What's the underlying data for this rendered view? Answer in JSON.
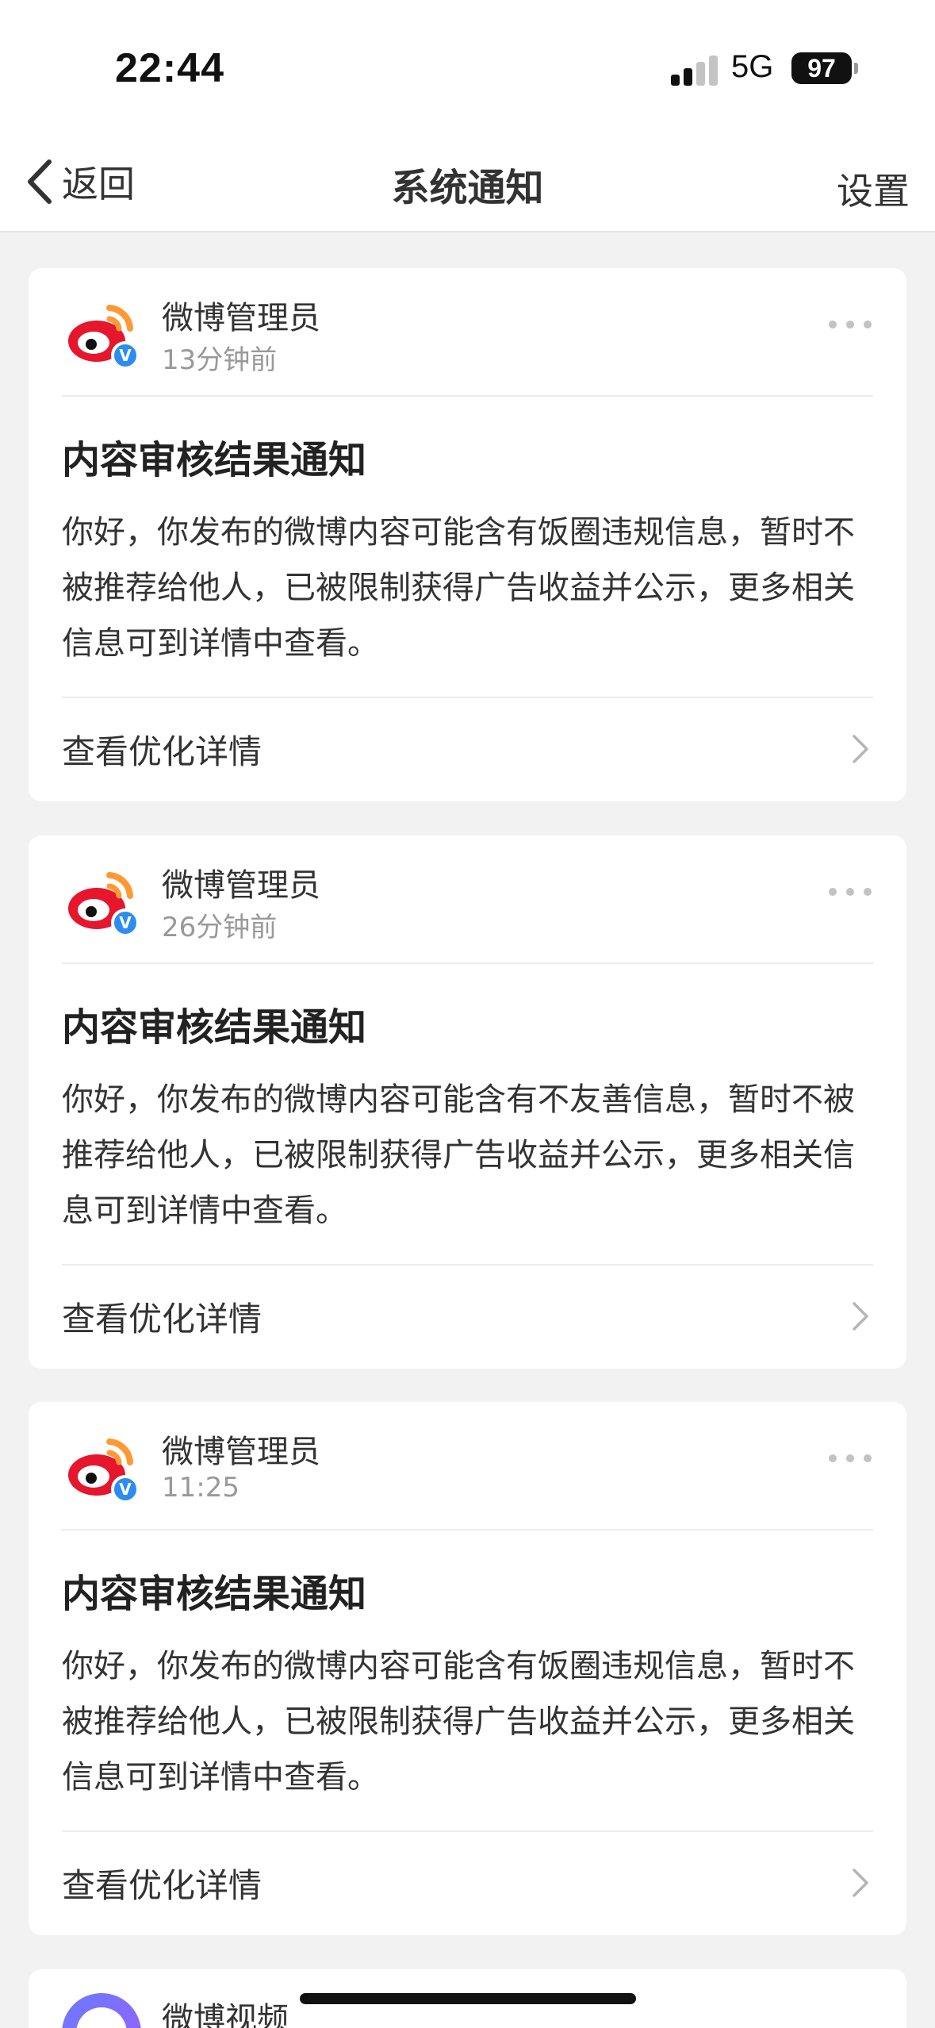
{
  "status_bar": {
    "time": "22:44",
    "network": "5G",
    "battery": "97"
  },
  "nav": {
    "back_label": "返回",
    "title": "系统通知",
    "settings_label": "设置"
  },
  "notifications": [
    {
      "sender": "微博管理员",
      "time": "13分钟前",
      "title": "内容审核结果通知",
      "body": "你好，你发布的微博内容可能含有饭圈违规信息，暂时不被推荐给他人，已被限制获得广告收益并公示，更多相关信息可到详情中查看。",
      "link_label": "查看优化详情"
    },
    {
      "sender": "微博管理员",
      "time": "26分钟前",
      "title": "内容审核结果通知",
      "body": "你好，你发布的微博内容可能含有不友善信息，暂时不被推荐给他人，已被限制获得广告收益并公示，更多相关信息可到详情中查看。",
      "link_label": "查看优化详情"
    },
    {
      "sender": "微博管理员",
      "time": "11:25",
      "title": "内容审核结果通知",
      "body": "你好，你发布的微博内容可能含有饭圈违规信息，暂时不被推荐给他人，已被限制获得广告收益并公示，更多相关信息可到详情中查看。",
      "link_label": "查看优化详情"
    }
  ],
  "partial_notification": {
    "sender": "微博视频"
  },
  "icons": {
    "back": "chevron-left-icon",
    "more": "more-dots-icon",
    "detail": "chevron-right-icon",
    "verified": "verified-badge-icon",
    "weibo": "weibo-logo-icon"
  },
  "colors": {
    "background": "#f2f2f2",
    "card": "#ffffff",
    "verified_blue": "#2d8cf0",
    "weibo_red": "#e6162d",
    "weibo_orange": "#ff9933"
  }
}
